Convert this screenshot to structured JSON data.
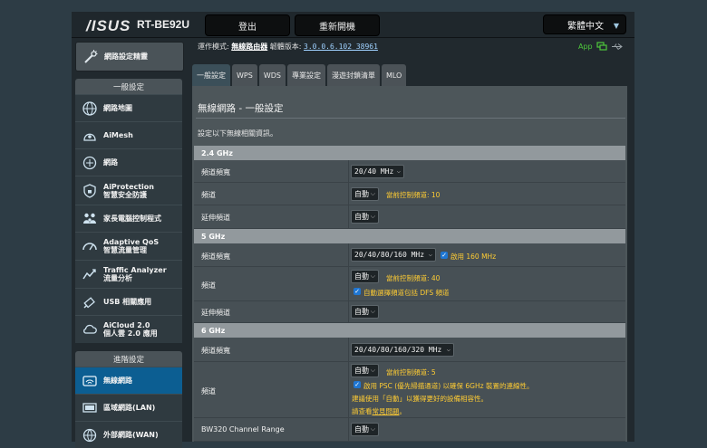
{
  "header": {
    "logo": "/ISUS",
    "model": "RT-BE92U",
    "logout": "登出",
    "reboot": "重新開機",
    "language": "繁體中文"
  },
  "status_bar": {
    "mode_label": "運作模式:",
    "mode_value": "無線路由器",
    "fw_label": "韌體版本:",
    "fw_value": "3.0.0.6.102_38961",
    "app_label": "App"
  },
  "sidebar": {
    "quick_setup": "網路設定精靈",
    "general_header": "一般設定",
    "general_items": [
      {
        "label": "網路地圖",
        "sub": "",
        "icon": "globe-icon"
      },
      {
        "label": "AiMesh",
        "sub": "",
        "icon": "mesh-icon"
      },
      {
        "label": "網路",
        "sub": "",
        "icon": "network-icon"
      },
      {
        "label": "AiProtection",
        "sub": "智慧安全防護",
        "icon": "shield-icon"
      },
      {
        "label": "家長電腦控制程式",
        "sub": "",
        "icon": "family-icon"
      },
      {
        "label": "Adaptive QoS",
        "sub": "智慧流量管理",
        "icon": "gauge-icon"
      },
      {
        "label": "Traffic Analyzer",
        "sub": "流量分析",
        "icon": "chart-icon"
      },
      {
        "label": "USB 相關應用",
        "sub": "",
        "icon": "usb-icon"
      },
      {
        "label": "AiCloud 2.0",
        "sub": "個人雲 2.0 應用",
        "icon": "cloud-icon"
      }
    ],
    "advanced_header": "進階設定",
    "advanced_items": [
      {
        "label": "無線網路",
        "icon": "wifi-icon"
      },
      {
        "label": "區域網路(LAN)",
        "icon": "lan-icon"
      },
      {
        "label": "外部網路(WAN)",
        "icon": "wan-icon"
      }
    ]
  },
  "tabs": [
    "一般設定",
    "WPS",
    "WDS",
    "專業設定",
    "漫遊封鎖清單",
    "MLO"
  ],
  "panel": {
    "title": "無線網路 - 一般設定",
    "description": "設定以下無線相關資訊。"
  },
  "band_24": {
    "header": "2.4 GHz",
    "bandwidth_label": "頻道頻寬",
    "bandwidth_value": "20/40 MHz",
    "channel_label": "頻道",
    "channel_value": "自動",
    "channel_note": "當前控制頻道: 10",
    "ext_label": "延伸頻道",
    "ext_value": "自動"
  },
  "band_5": {
    "header": "5 GHz",
    "bandwidth_label": "頻道頻寬",
    "bandwidth_value": "20/40/80/160 MHz",
    "enable160": "啟用 160 MHz",
    "channel_label": "頻道",
    "channel_value": "自動",
    "channel_note": "當前控制頻道: 40",
    "dfs_note": "自動選擇頻道包括 DFS 頻道",
    "ext_label": "延伸頻道",
    "ext_value": "自動"
  },
  "band_6": {
    "header": "6 GHz",
    "bandwidth_label": "頻道頻寬",
    "bandwidth_value": "20/40/80/160/320 MHz",
    "channel_label": "頻道",
    "channel_value": "自動",
    "channel_note": "當前控制頻道: 5",
    "psc_note": "啟用 PSC (優先掃描通道) 以確保 6GHz 裝置的連線性。",
    "suggest_note": "建議使用「自動」以獲得更好的設備相容性。",
    "faq_prefix": "請查看",
    "faq_link": "常見問題",
    "faq_suffix": "。",
    "bw320_label": "BW320 Channel Range",
    "bw320_value": "自動"
  }
}
